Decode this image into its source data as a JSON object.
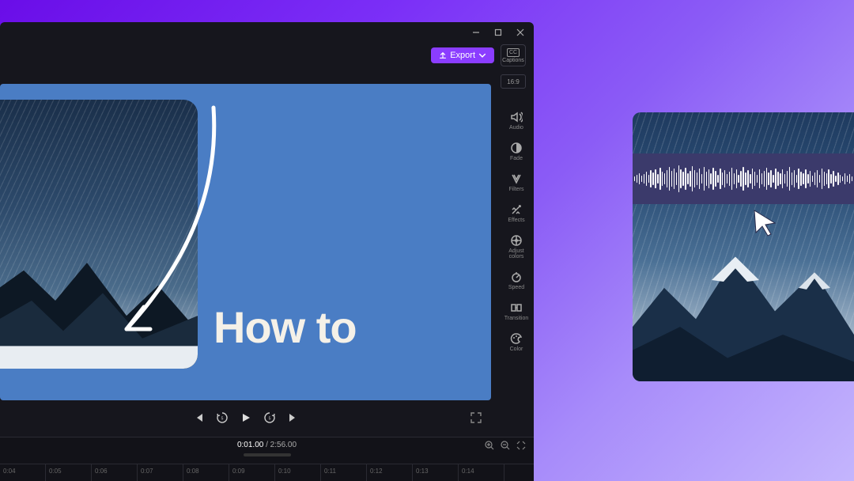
{
  "window": {
    "export_label": "Export",
    "captions_label": "Captions",
    "aspect_label": "16:9"
  },
  "preview": {
    "overlay_text": "How to"
  },
  "playback": {
    "current_time": "0:01.00",
    "total_time": "2:56.00"
  },
  "right_tools": [
    {
      "id": "audio",
      "label": "Audio"
    },
    {
      "id": "fade",
      "label": "Fade"
    },
    {
      "id": "filters",
      "label": "Filters"
    },
    {
      "id": "effects",
      "label": "Effects"
    },
    {
      "id": "adjust-colors",
      "label": "Adjust colors"
    },
    {
      "id": "speed",
      "label": "Speed"
    },
    {
      "id": "transition",
      "label": "Transition"
    },
    {
      "id": "color",
      "label": "Color"
    }
  ],
  "timeline": {
    "ticks": [
      "0:04",
      "0:05",
      "0:06",
      "0:07",
      "0:08",
      "0:09",
      "0:10",
      "0:11",
      "0:12",
      "0:13",
      "0:14"
    ]
  },
  "waveform_heights": [
    6,
    10,
    14,
    8,
    12,
    18,
    10,
    22,
    16,
    24,
    12,
    28,
    18,
    14,
    22,
    30,
    20,
    26,
    16,
    34,
    24,
    18,
    28,
    14,
    20,
    32,
    22,
    16,
    26,
    12,
    30,
    18,
    24,
    14,
    28,
    20,
    10,
    26,
    16,
    22,
    12,
    18,
    28,
    14,
    24,
    10,
    20,
    30,
    16,
    22,
    12,
    26,
    18,
    10,
    24,
    14,
    20,
    28,
    16,
    22,
    10,
    26,
    18,
    14,
    24,
    12,
    20,
    30,
    16,
    22,
    10,
    26,
    18,
    14,
    24,
    12,
    20,
    8,
    16,
    22,
    10,
    26,
    18,
    14,
    24,
    12,
    20,
    8,
    16,
    10,
    6,
    14,
    8,
    12,
    6,
    10,
    8,
    6,
    4,
    8,
    6,
    4,
    6,
    4,
    3,
    4,
    3,
    2,
    3,
    2,
    3,
    2,
    3,
    2
  ]
}
